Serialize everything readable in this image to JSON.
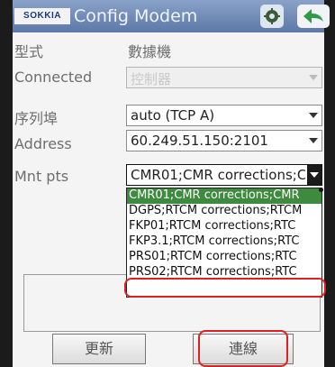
{
  "titlebar": {
    "brand": "SOKKIA",
    "title": "Config Modem",
    "icon1": "settings-icon",
    "icon2": "back-arrow-icon"
  },
  "form": {
    "type_label": "型式",
    "type_value": "數據機",
    "connected_label": "Connected",
    "connected_value": "控制器",
    "port_label": "序列埠",
    "port_value": "auto (TCP A)",
    "address_label": "Address",
    "address_value": "60.249.51.150:2101",
    "mntpts_label": "Mnt pts",
    "mntpts_value": "CMR01;CMR corrections;CI"
  },
  "mountpoints": [
    "CMR01;CMR corrections;CMR",
    "DGPS;RTCM corrections;RTCM",
    "FKP01;RTCM corrections;RTC",
    "FKP3.1;RTCM corrections;RTC",
    "PRS01;RTCM corrections;RTC",
    "PRS02;RTCM corrections;RTC"
  ],
  "selected_index": 0,
  "highlighted_index": 5,
  "buttons": {
    "refresh": "更新",
    "connect": "連線"
  },
  "colors": {
    "highlight_red": "#e02020",
    "selection_green": "#3e8a3e"
  }
}
